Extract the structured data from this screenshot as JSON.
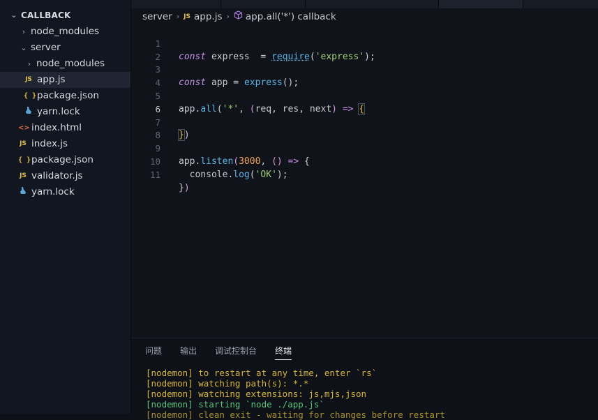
{
  "sidebar": {
    "title": "CALLBACK",
    "items": [
      {
        "label": "node_modules",
        "type": "folder",
        "expanded": false,
        "depth": 1
      },
      {
        "label": "server",
        "type": "folder",
        "expanded": true,
        "depth": 1
      },
      {
        "label": "node_modules",
        "type": "folder",
        "expanded": false,
        "depth": 2
      },
      {
        "label": "app.js",
        "type": "js",
        "depth": 2,
        "active": true
      },
      {
        "label": "package.json",
        "type": "json",
        "depth": 2
      },
      {
        "label": "yarn.lock",
        "type": "yarn",
        "depth": 2
      },
      {
        "label": "index.html",
        "type": "html",
        "depth": 1
      },
      {
        "label": "index.js",
        "type": "js",
        "depth": 1
      },
      {
        "label": "package.json",
        "type": "json",
        "depth": 1
      },
      {
        "label": "validator.js",
        "type": "js",
        "depth": 1
      },
      {
        "label": "yarn.lock",
        "type": "yarn",
        "depth": 1
      }
    ]
  },
  "icons": {
    "js": "JS",
    "json": "{ }",
    "html": "<>",
    "yarn": "yarn-icon"
  },
  "breadcrumb": {
    "folder": "server",
    "file": "app.js",
    "symbol": "app.all('*') callback"
  },
  "editor": {
    "line_numbers": [
      "1",
      "2",
      "3",
      "4",
      "5",
      "6",
      "7",
      "8",
      "9",
      "10",
      "11"
    ],
    "current_line": 6,
    "code": {
      "l1_const": "const",
      "l1_name": " express  = ",
      "l1_fn": "require",
      "l1_open": "(",
      "l1_str": "'express'",
      "l1_close": ");",
      "l3_const": "const",
      "l3_name": " app = ",
      "l3_fn": "express",
      "l3_rest": "();",
      "l5_obj": "app.",
      "l5_fn": "all",
      "l5_open": "(",
      "l5_str": "'*'",
      "l5_comma": ", ",
      "l5_params_open": "(",
      "l5_params": "req, res, next",
      "l5_params_close": ")",
      "l5_arrow": " => ",
      "l5_brace": "{",
      "l7_brace": "}",
      "l7_paren": ")",
      "l9_obj": "app.",
      "l9_fn": "listen",
      "l9_open": "(",
      "l9_num": "3000",
      "l9_comma": ", ",
      "l9_params": "()",
      "l9_arrow": " => ",
      "l9_brace": "{",
      "l10_obj": "  console.",
      "l10_fn": "log",
      "l10_open": "(",
      "l10_str": "'OK'",
      "l10_close": ");",
      "l11_brace": "}",
      "l11_paren": ")"
    }
  },
  "panel": {
    "tabs": [
      "问题",
      "输出",
      "调试控制台",
      "终端"
    ],
    "active_tab": "终端",
    "terminal_lines": [
      "[nodemon] to restart at any time, enter `rs`",
      "[nodemon] watching path(s): *.*",
      "[nodemon] watching extensions: js,mjs,json",
      "[nodemon] starting `node ./app.js`",
      "[nodemon] clean exit - waiting for changes before restart"
    ]
  },
  "colors": {
    "sidebar_bg": "#121620",
    "editor_bg": "#101319",
    "keyword": "#c594e6",
    "function": "#5fb3e4",
    "string": "#9fd07a",
    "number": "#f0a45d",
    "terminal_yellow": "#d7b53f",
    "terminal_green": "#59c27a"
  }
}
